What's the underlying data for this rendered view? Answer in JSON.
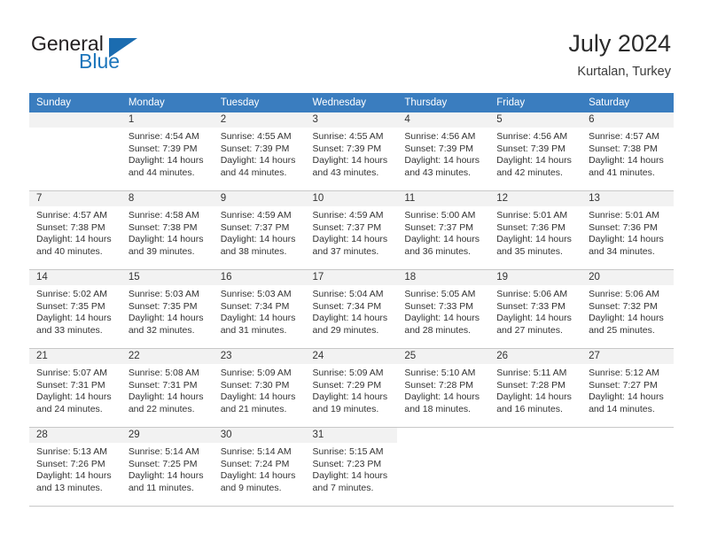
{
  "brand": {
    "word_one": "General",
    "word_two": "Blue",
    "triangle_color": "#1b6cb0",
    "blue_text_color": "#1b75bb"
  },
  "header": {
    "title": "July 2024",
    "subtitle": "Kurtalan, Turkey",
    "header_bg": "#3a7dbf",
    "daynum_bg": "#f2f2f2"
  },
  "weekdays": [
    "Sunday",
    "Monday",
    "Tuesday",
    "Wednesday",
    "Thursday",
    "Friday",
    "Saturday"
  ],
  "labels": {
    "sunrise_prefix": "Sunrise:",
    "sunset_prefix": "Sunset:",
    "daylight_prefix": "Daylight:"
  },
  "weeks": [
    [
      {
        "day": "",
        "blank": true,
        "line1": "",
        "line2": "",
        "line3": "",
        "line4": ""
      },
      {
        "day": "1",
        "line1": "Sunrise: 4:54 AM",
        "line2": "Sunset: 7:39 PM",
        "line3": "Daylight: 14 hours",
        "line4": "and 44 minutes."
      },
      {
        "day": "2",
        "line1": "Sunrise: 4:55 AM",
        "line2": "Sunset: 7:39 PM",
        "line3": "Daylight: 14 hours",
        "line4": "and 44 minutes."
      },
      {
        "day": "3",
        "line1": "Sunrise: 4:55 AM",
        "line2": "Sunset: 7:39 PM",
        "line3": "Daylight: 14 hours",
        "line4": "and 43 minutes."
      },
      {
        "day": "4",
        "line1": "Sunrise: 4:56 AM",
        "line2": "Sunset: 7:39 PM",
        "line3": "Daylight: 14 hours",
        "line4": "and 43 minutes."
      },
      {
        "day": "5",
        "line1": "Sunrise: 4:56 AM",
        "line2": "Sunset: 7:39 PM",
        "line3": "Daylight: 14 hours",
        "line4": "and 42 minutes."
      },
      {
        "day": "6",
        "line1": "Sunrise: 4:57 AM",
        "line2": "Sunset: 7:38 PM",
        "line3": "Daylight: 14 hours",
        "line4": "and 41 minutes."
      }
    ],
    [
      {
        "day": "7",
        "line1": "Sunrise: 4:57 AM",
        "line2": "Sunset: 7:38 PM",
        "line3": "Daylight: 14 hours",
        "line4": "and 40 minutes."
      },
      {
        "day": "8",
        "line1": "Sunrise: 4:58 AM",
        "line2": "Sunset: 7:38 PM",
        "line3": "Daylight: 14 hours",
        "line4": "and 39 minutes."
      },
      {
        "day": "9",
        "line1": "Sunrise: 4:59 AM",
        "line2": "Sunset: 7:37 PM",
        "line3": "Daylight: 14 hours",
        "line4": "and 38 minutes."
      },
      {
        "day": "10",
        "line1": "Sunrise: 4:59 AM",
        "line2": "Sunset: 7:37 PM",
        "line3": "Daylight: 14 hours",
        "line4": "and 37 minutes."
      },
      {
        "day": "11",
        "line1": "Sunrise: 5:00 AM",
        "line2": "Sunset: 7:37 PM",
        "line3": "Daylight: 14 hours",
        "line4": "and 36 minutes."
      },
      {
        "day": "12",
        "line1": "Sunrise: 5:01 AM",
        "line2": "Sunset: 7:36 PM",
        "line3": "Daylight: 14 hours",
        "line4": "and 35 minutes."
      },
      {
        "day": "13",
        "line1": "Sunrise: 5:01 AM",
        "line2": "Sunset: 7:36 PM",
        "line3": "Daylight: 14 hours",
        "line4": "and 34 minutes."
      }
    ],
    [
      {
        "day": "14",
        "line1": "Sunrise: 5:02 AM",
        "line2": "Sunset: 7:35 PM",
        "line3": "Daylight: 14 hours",
        "line4": "and 33 minutes."
      },
      {
        "day": "15",
        "line1": "Sunrise: 5:03 AM",
        "line2": "Sunset: 7:35 PM",
        "line3": "Daylight: 14 hours",
        "line4": "and 32 minutes."
      },
      {
        "day": "16",
        "line1": "Sunrise: 5:03 AM",
        "line2": "Sunset: 7:34 PM",
        "line3": "Daylight: 14 hours",
        "line4": "and 31 minutes."
      },
      {
        "day": "17",
        "line1": "Sunrise: 5:04 AM",
        "line2": "Sunset: 7:34 PM",
        "line3": "Daylight: 14 hours",
        "line4": "and 29 minutes."
      },
      {
        "day": "18",
        "line1": "Sunrise: 5:05 AM",
        "line2": "Sunset: 7:33 PM",
        "line3": "Daylight: 14 hours",
        "line4": "and 28 minutes."
      },
      {
        "day": "19",
        "line1": "Sunrise: 5:06 AM",
        "line2": "Sunset: 7:33 PM",
        "line3": "Daylight: 14 hours",
        "line4": "and 27 minutes."
      },
      {
        "day": "20",
        "line1": "Sunrise: 5:06 AM",
        "line2": "Sunset: 7:32 PM",
        "line3": "Daylight: 14 hours",
        "line4": "and 25 minutes."
      }
    ],
    [
      {
        "day": "21",
        "line1": "Sunrise: 5:07 AM",
        "line2": "Sunset: 7:31 PM",
        "line3": "Daylight: 14 hours",
        "line4": "and 24 minutes."
      },
      {
        "day": "22",
        "line1": "Sunrise: 5:08 AM",
        "line2": "Sunset: 7:31 PM",
        "line3": "Daylight: 14 hours",
        "line4": "and 22 minutes."
      },
      {
        "day": "23",
        "line1": "Sunrise: 5:09 AM",
        "line2": "Sunset: 7:30 PM",
        "line3": "Daylight: 14 hours",
        "line4": "and 21 minutes."
      },
      {
        "day": "24",
        "line1": "Sunrise: 5:09 AM",
        "line2": "Sunset: 7:29 PM",
        "line3": "Daylight: 14 hours",
        "line4": "and 19 minutes."
      },
      {
        "day": "25",
        "line1": "Sunrise: 5:10 AM",
        "line2": "Sunset: 7:28 PM",
        "line3": "Daylight: 14 hours",
        "line4": "and 18 minutes."
      },
      {
        "day": "26",
        "line1": "Sunrise: 5:11 AM",
        "line2": "Sunset: 7:28 PM",
        "line3": "Daylight: 14 hours",
        "line4": "and 16 minutes."
      },
      {
        "day": "27",
        "line1": "Sunrise: 5:12 AM",
        "line2": "Sunset: 7:27 PM",
        "line3": "Daylight: 14 hours",
        "line4": "and 14 minutes."
      }
    ],
    [
      {
        "day": "28",
        "line1": "Sunrise: 5:13 AM",
        "line2": "Sunset: 7:26 PM",
        "line3": "Daylight: 14 hours",
        "line4": "and 13 minutes."
      },
      {
        "day": "29",
        "line1": "Sunrise: 5:14 AM",
        "line2": "Sunset: 7:25 PM",
        "line3": "Daylight: 14 hours",
        "line4": "and 11 minutes."
      },
      {
        "day": "30",
        "line1": "Sunrise: 5:14 AM",
        "line2": "Sunset: 7:24 PM",
        "line3": "Daylight: 14 hours",
        "line4": "and 9 minutes."
      },
      {
        "day": "31",
        "line1": "Sunrise: 5:15 AM",
        "line2": "Sunset: 7:23 PM",
        "line3": "Daylight: 14 hours",
        "line4": "and 7 minutes."
      },
      {
        "day": "",
        "void": true,
        "line1": "",
        "line2": "",
        "line3": "",
        "line4": ""
      },
      {
        "day": "",
        "void": true,
        "line1": "",
        "line2": "",
        "line3": "",
        "line4": ""
      },
      {
        "day": "",
        "void": true,
        "line1": "",
        "line2": "",
        "line3": "",
        "line4": ""
      }
    ]
  ]
}
